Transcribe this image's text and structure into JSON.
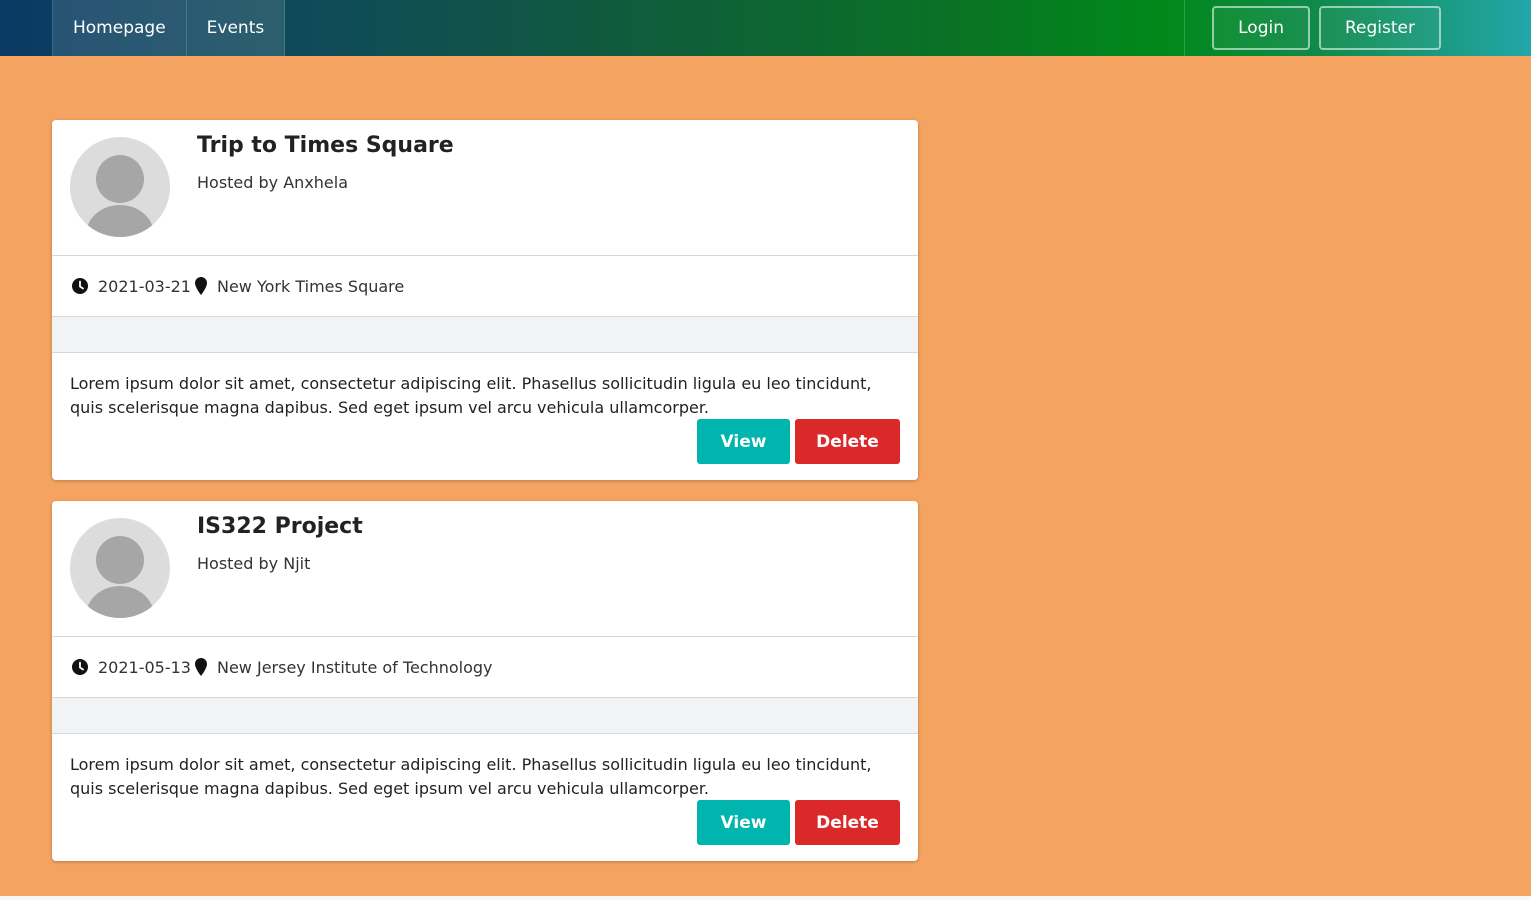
{
  "nav": {
    "items": [
      {
        "label": "Homepage"
      },
      {
        "label": "Events"
      }
    ],
    "login_label": "Login",
    "register_label": "Register"
  },
  "events": [
    {
      "title": "Trip to Times Square",
      "host": "Hosted by Anxhela",
      "date": "2021-03-21",
      "location": "New York Times Square",
      "description": "Lorem ipsum dolor sit amet, consectetur adipiscing elit. Phasellus sollicitudin ligula eu leo tincidunt, quis scelerisque magna dapibus. Sed eget ipsum vel arcu vehicula ullamcorper.",
      "view_label": "View",
      "delete_label": "Delete"
    },
    {
      "title": "IS322 Project",
      "host": "Hosted by Njit",
      "date": "2021-05-13",
      "location": "New Jersey Institute of Technology",
      "description": "Lorem ipsum dolor sit amet, consectetur adipiscing elit. Phasellus sollicitudin ligula eu leo tincidunt, quis scelerisque magna dapibus. Sed eget ipsum vel arcu vehicula ullamcorper.",
      "view_label": "View",
      "delete_label": "Delete"
    }
  ],
  "icons": {
    "date": "clock-icon",
    "location": "map-marker-icon",
    "avatar": "user-avatar-icon"
  },
  "colors": {
    "page_background": "#f4a460",
    "view_button": "#00b5ad",
    "delete_button": "#db2828"
  }
}
